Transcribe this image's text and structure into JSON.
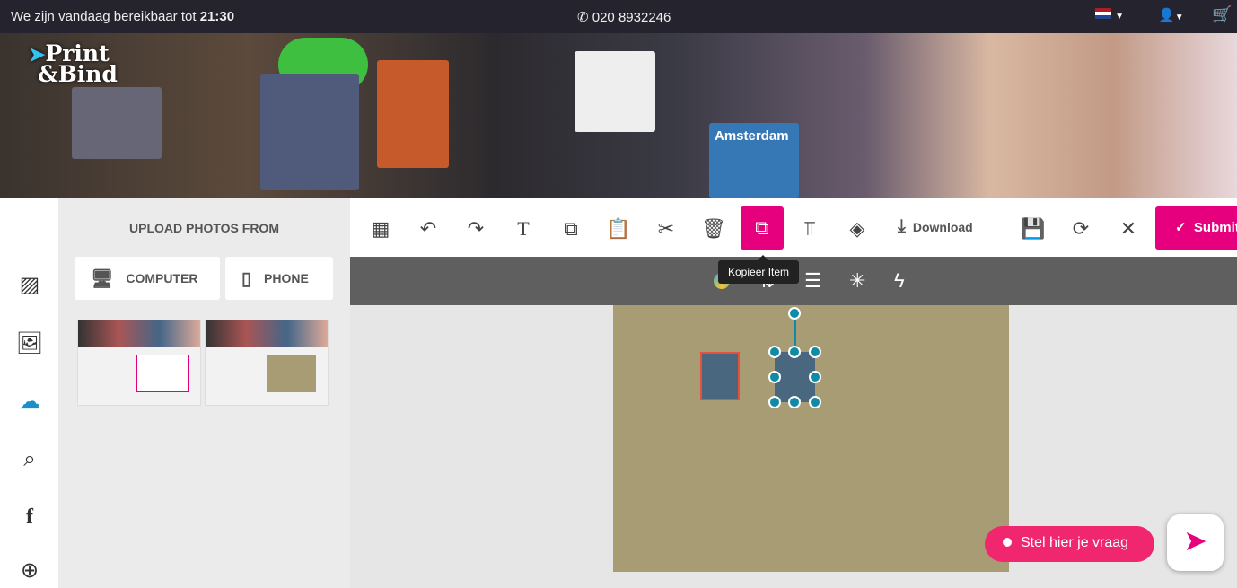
{
  "topbar": {
    "availability": "We zijn vandaag bereikbaar tot",
    "time": "21:30",
    "phone": "020 8932246",
    "phone_icon": "phone-icon",
    "flag": "nl-flag",
    "user_icon": "user-icon",
    "cart_icon": "cart-icon"
  },
  "banner": {
    "logo_line1": "Print",
    "logo_line2": "&Bind",
    "card_text": "Amsterdam"
  },
  "sidebar": {
    "items": [
      "pattern",
      "image",
      "upload",
      "search",
      "facebook",
      "zoom-in"
    ]
  },
  "upload": {
    "title": "UPLOAD PHOTOS FROM",
    "computer": "COMPUTER",
    "phone": "PHONE"
  },
  "toolbar": {
    "download": "Download",
    "submit": "Submit",
    "tooltip": "Kopieer Item",
    "accent": "#e6007e"
  },
  "canvas": {
    "background": "#a89c74"
  },
  "chat": {
    "label": "Stel hier je vraag"
  }
}
